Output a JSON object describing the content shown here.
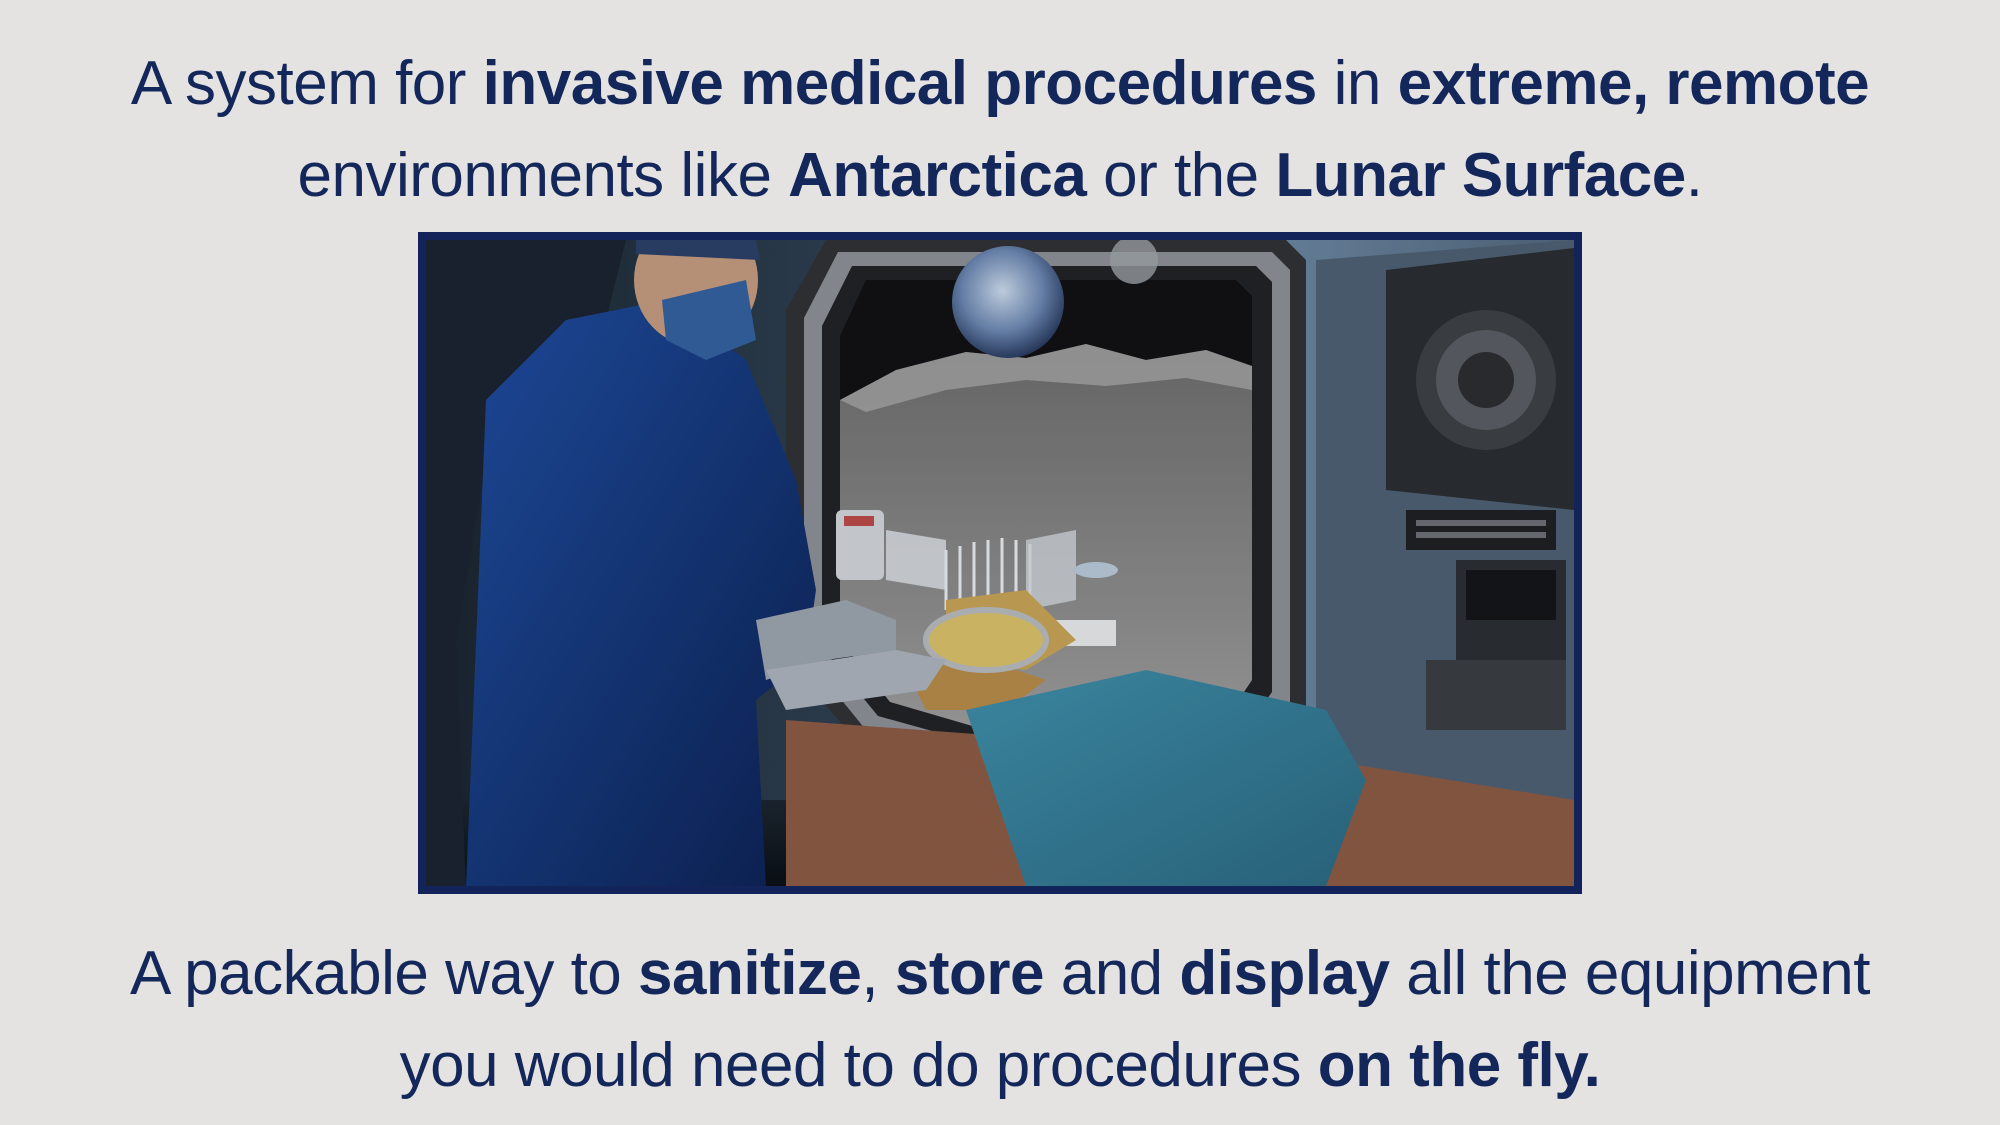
{
  "headline": {
    "t1": "A system for ",
    "b1": "invasive medical procedures",
    "t2": " in ",
    "b2": "extreme, remote",
    "t3": "environments like ",
    "b3": "Antarctica",
    "t4": " or the ",
    "b4": "Lunar Surface",
    "t5": "."
  },
  "tagline": {
    "t1": "A packable way to ",
    "b1": "sanitize",
    "t2": ", ",
    "b2": "store",
    "t3": " and ",
    "b3": "display",
    "t4": " all the equipment",
    "t5": "you would need to do procedures ",
    "b4": "on the fly."
  },
  "colors": {
    "text": "#14275a",
    "background": "#e4e3e2",
    "frame_border": "#13245a"
  }
}
